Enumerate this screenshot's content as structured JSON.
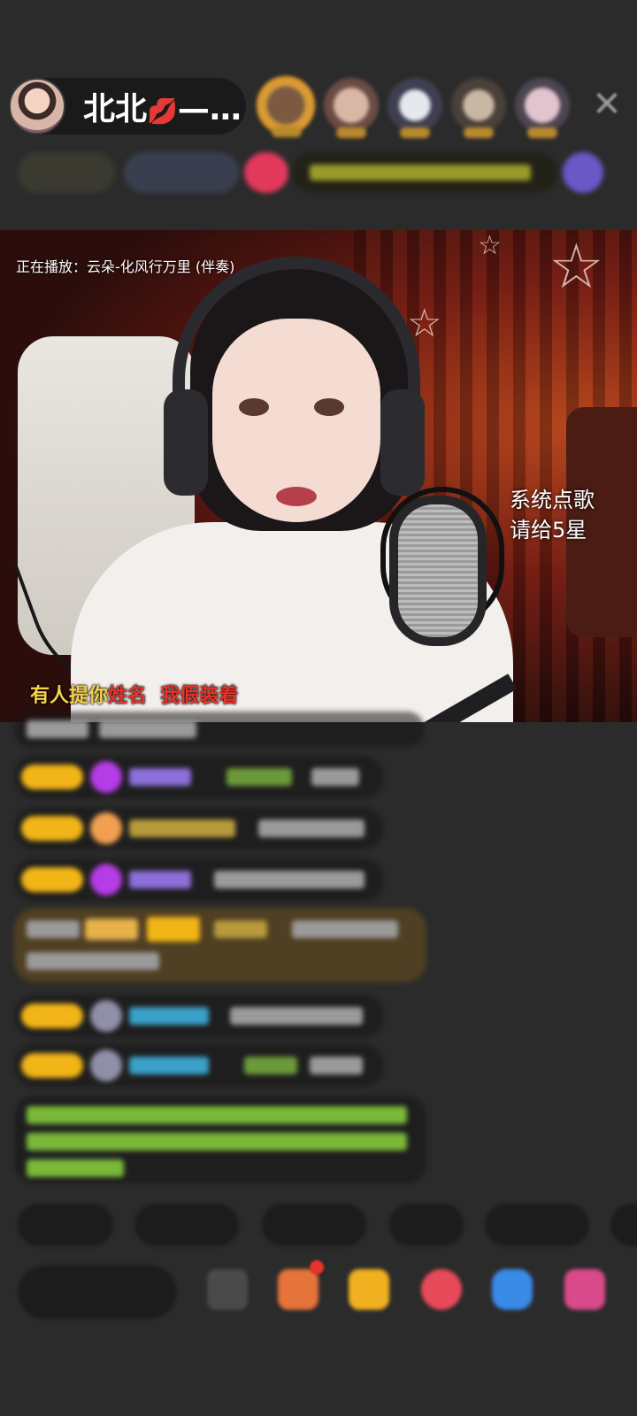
{
  "header": {
    "host_name": "北北",
    "host_name_suffix": "—…",
    "kiss_icon": "💋",
    "viewer_count": 5,
    "close_glyph": "✕"
  },
  "video": {
    "now_playing": "正在播放：云朵-化风行万里 (伴奏)",
    "system_song_line1": "系统点歌",
    "system_song_line2": "请给5星",
    "lyrics": {
      "part1": "有人提你",
      "part2": "姓名",
      "part3": "我假装着"
    }
  },
  "colors": {
    "background": "#2b2b2b",
    "level_badge": "#f2b517",
    "lyric_yellow": "#f5d24a",
    "lyric_red": "#e8332a"
  }
}
